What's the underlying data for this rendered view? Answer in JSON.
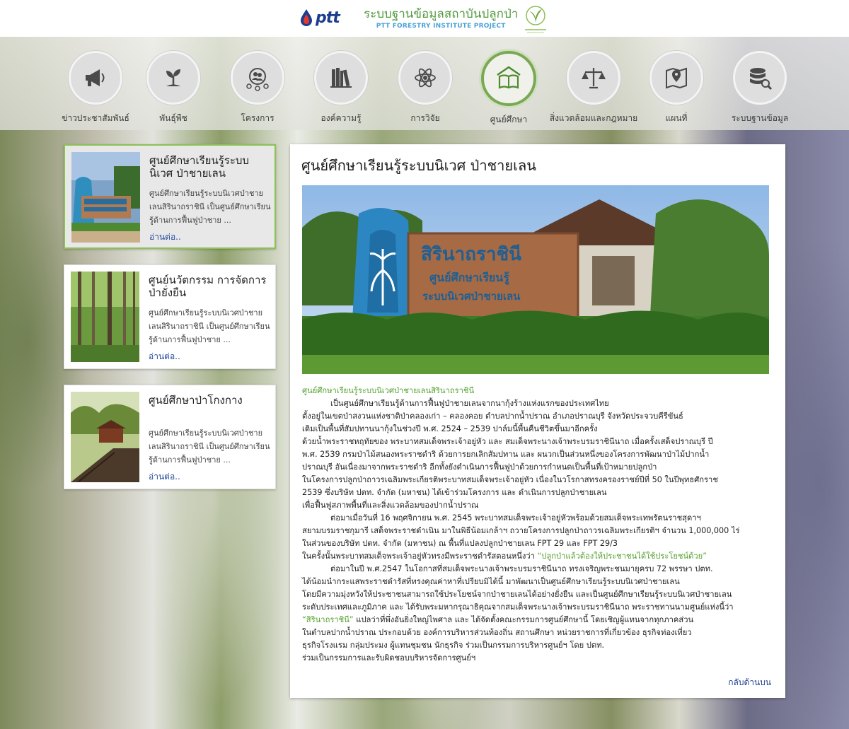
{
  "header": {
    "logo_text": "ptt",
    "title_th": "ระบบฐานข้อมูลสถาบันปลูกป่า",
    "title_en": "PTT FORESTRY INSTITUTE PROJECT"
  },
  "nav": [
    {
      "label": "ข่าวประชาสัมพันธ์",
      "icon": "megaphone-icon"
    },
    {
      "label": "พันธุ์พืช",
      "icon": "seedling-icon"
    },
    {
      "label": "โครงการ",
      "icon": "people-network-icon"
    },
    {
      "label": "องค์ความรู้",
      "icon": "books-icon"
    },
    {
      "label": "การวิจัย",
      "icon": "atom-icon"
    },
    {
      "label": "ศูนย์ศึกษา",
      "icon": "open-book-house-icon",
      "active": true
    },
    {
      "label": "สิ่งแวดล้อมและกฎหมาย",
      "icon": "scales-icon"
    },
    {
      "label": "แผนที่",
      "icon": "map-pin-icon"
    },
    {
      "label": "ระบบฐานข้อมูล",
      "icon": "database-search-icon"
    }
  ],
  "sidebar": [
    {
      "title": "ศูนย์ศึกษาเรียนรู้ระบบนิเวศ ป่าชายเลน",
      "desc": "ศูนย์ศึกษาเรียนรู้ระบบนิเวศป่าชายเลนสิรินาถราชินี เป็นศูนย์ศึกษาเรียนรู้ด้านการฟื้นฟูป่าชาย ...",
      "more": "อ่านต่อ.."
    },
    {
      "title": "ศูนย์นวัตกรรม การจัดการป่ายั่งยืน",
      "desc": "ศูนย์ศึกษาเรียนรู้ระบบนิเวศป่าชายเลนสิรินาถราชินี เป็นศูนย์ศึกษาเรียนรู้ด้านการฟื้นฟูป่าชาย ...",
      "more": "อ่านต่อ.."
    },
    {
      "title": "ศูนย์ศึกษาป่าโกงกาง",
      "desc": "ศูนย์ศึกษาเรียนรู้ระบบนิเวศป่าชายเลนสิรินาถราชินี เป็นศูนย์ศึกษาเรียนรู้ด้านการฟื้นฟูป่าชาย ...",
      "more": "อ่านต่อ.."
    }
  ],
  "main": {
    "title": "ศูนย์ศึกษาเรียนรู้ระบบนิเวศ ป่าชายเลน",
    "sign_line1": "สิรินาถราชินี",
    "sign_line2": "ศูนย์ศึกษาเรียนรู้",
    "sign_line3": "ระบบนิเวศป่าชายเลน",
    "back_to_top": "กลับด้านบน",
    "lines": [
      {
        "t": "ศูนย์ศึกษาเรียนรู้ระบบนิเวศป่าชายเลนสิรินาถราชินี",
        "cls": "green"
      },
      {
        "t": "เป็นศูนย์ศึกษาเรียนรู้ด้านการฟื้นฟูป่าชายเลนจากนากุ้งร้างแห่งแรกของประเทศไทย",
        "cls": "ind"
      },
      {
        "t": "ตั้งอยู่ในเขตป่าสงวนแห่งชาติป่าคลองเก่า – คลองคอย ตำบลปากน้ำปราณ อำเภอปราณบุรี จังหวัดประจวบคีรีขันธ์",
        "cls": ""
      },
      {
        "t": "เดิมเป็นพื้นที่สัมปทานนากุ้งในช่วงปี พ.ศ. 2524 – 2539 ปาล์มนี้พื้นคืนชีวิตขึ้นมาอีกครั้ง",
        "cls": ""
      },
      {
        "t": "ด้วยน้ำพระราชหฤทัยของ พระบาทสมเด็จพระเจ้าอยู่หัว และ สมเด็จพระนางเจ้าพระบรมราชินีนาถ เมื่อครั้งเสด็จปราณบุรี ปี",
        "cls": ""
      },
      {
        "t": "พ.ศ. 2539 กรมป่าไม้สนองพระราชดำริ ด้วยการยกเลิกสัมปทาน และ ผนวกเป็นส่วนหนึ่งของโครงการพัฒนาป่าไม้ปากน้ำ",
        "cls": ""
      },
      {
        "t": "ปราณบุรี อันเนื่องมาจากพระราชดำริ อีกทั้งยังดำเนินการฟื้นฟูป่าด้วยการกำหนดเป็นพื้นที่เป้าหมายปลูกป่า",
        "cls": ""
      },
      {
        "t": "ในโครงการปลูกป่าถาวรเฉลิมพระเกียรติพระบาทสมเด็จพระเจ้าอยู่หัว เนื่องในวโรกาสทรงครองราชย์ปีที่ 50 ในปีพุทธศักราช",
        "cls": ""
      },
      {
        "t": "2539 ซึ่งบริษัท ปตท. จำกัด (มหาชน) ได้เข้าร่วมโครงการ และ ดำเนินการปลูกป่าชายเลน",
        "cls": ""
      },
      {
        "t": "เพื่อฟื้นฟูสภาพพื้นที่และสิ่งแวดล้อมของปากน้ำปราณ",
        "cls": ""
      },
      {
        "t": "ต่อมาเมื่อวันที่ 16 พฤศจิกายน พ.ศ. 2545 พระบาทสมเด็จพระเจ้าอยู่หัวพร้อมด้วยสมเด็จพระเทพรัตนราชสุดาฯ",
        "cls": "ind"
      },
      {
        "t": "สยามบรมราชกุมารี เสด็จพระราชดำเนิน มาในพิธีน้อมเกล้าฯ ถวายโครงการปลูกป่าถาวรเฉลิมพระเกียรติฯ จำนวน 1,000,000 ไร่",
        "cls": ""
      },
      {
        "t": "ในส่วนของบริษัท ปตท. จำกัด (มหาชน) ณ พื้นที่แปลงปลูกป่าชายเลน FPT 29 และ FPT 29/3",
        "cls": ""
      },
      {
        "t": "ในครั้งนั้นพระบาทสมเด็จพระเจ้าอยู่หัวทรงมีพระราชดำรัสตอนหนึ่งว่า ",
        "cls": "",
        "g": "“ปลูกป่าแล้วต้องให้ประชาชนได้ใช้ประโยชน์ด้วย”"
      },
      {
        "t": "ต่อมาในปี พ.ศ.2547 ในโอกาสที่สมเด็จพระนางเจ้าพระบรมราชินีนาถ ทรงเจริญพระชนมายุครบ 72 พรรษา ปตท.",
        "cls": "ind"
      },
      {
        "t": "ได้น้อมนำกระแสพระราชดำรัสที่ทรงคุณค่าหาที่เปรียบมิได้นี้ มาพัฒนาเป็นศูนย์ศึกษาเรียนรู้ระบบนิเวศป่าชายเลน",
        "cls": ""
      },
      {
        "t": "โดยมีความมุ่งหวังให้ประชาชนสามารถใช้ประโยชน์จากป่าชายเลนได้อย่างยั่งยืน และเป็นศูนย์ศึกษาเรียนรู้ระบบนิเวศป่าชายเลน",
        "cls": ""
      },
      {
        "t": "ระดับประเทศและภูมิภาค และ ได้รับพระมหากรุณาธิคุณจากสมเด็จพระนางเจ้าพระบรมราชินีนาถ พระราชทานนามศูนย์แห่งนี้ว่า",
        "cls": ""
      },
      {
        "g0": "“สิรินาถราชินี”",
        "t": " แปลว่าที่พึ่งอันยิ่งใหญ่ไพศาล และ ได้จัดตั้งคณะกรรมการศูนย์ศึกษานี้ โดยเชิญผู้แทนจากทุกภาคส่วน",
        "cls": ""
      },
      {
        "t": "ในตำบลปากน้ำปราณ ประกอบด้วย องค์การบริหารส่วนท้องถิ่น สถานศึกษา หน่วยราชการที่เกี่ยวข้อง ธุรกิจท่องเที่ยว",
        "cls": ""
      },
      {
        "t": "ธุรกิจโรงแรม กลุ่มประมง ผู้แทนชุมชน นักธุรกิจ ร่วมเป็นกรรมการบริหารศูนย์ฯ โดย ปตท.",
        "cls": ""
      },
      {
        "t": "ร่วมเป็นกรรมการและรับผิดชอบบริหารจัดการศูนย์ฯ",
        "cls": ""
      }
    ]
  }
}
